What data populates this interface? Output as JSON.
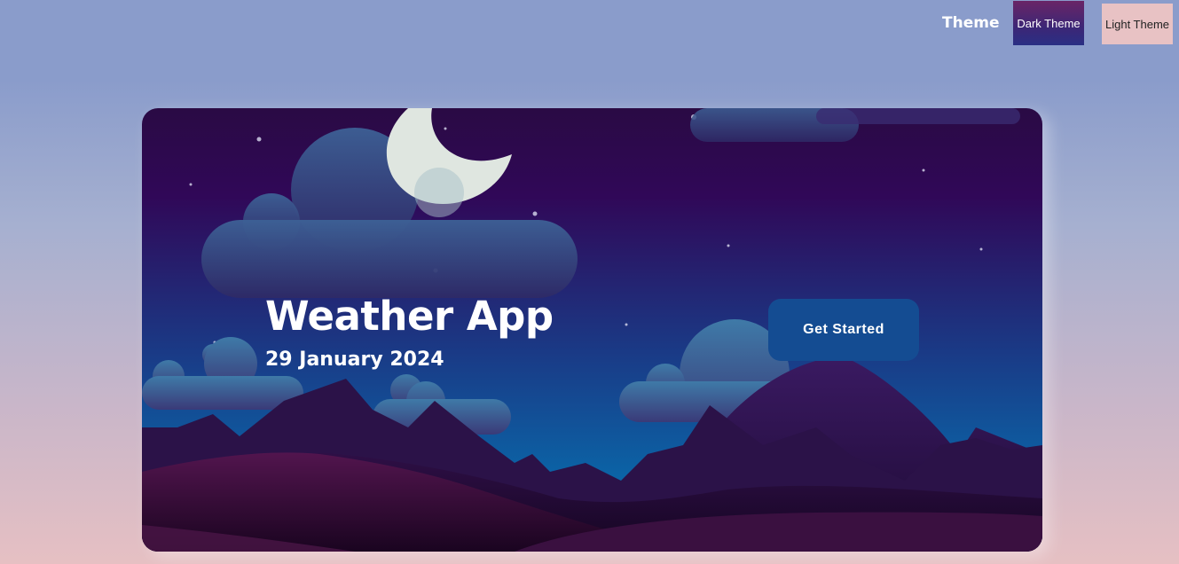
{
  "header": {
    "theme_label": "Theme",
    "dark_theme_label": "Dark Theme",
    "light_theme_label": "Light Theme"
  },
  "hero": {
    "title": "Weather App",
    "date": "29 January 2024",
    "cta_label": "Get Started"
  },
  "colors": {
    "page_top": "#8a9ccb",
    "page_bottom": "#e6c0c3",
    "sky_top": "#2a0a44",
    "sky_bottom": "#0a66a8",
    "cta": "#144c92",
    "moon": "#dfe6e0"
  }
}
